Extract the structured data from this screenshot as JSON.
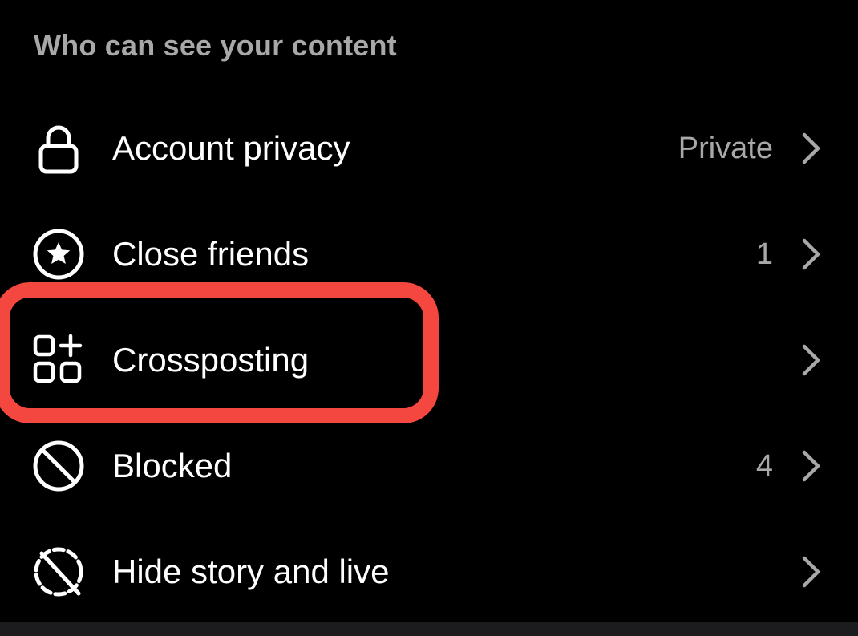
{
  "section": {
    "title": "Who can see your content"
  },
  "rows": [
    {
      "icon": "lock-icon",
      "label": "Account privacy",
      "value": "Private"
    },
    {
      "icon": "star-circle-icon",
      "label": "Close friends",
      "value": "1"
    },
    {
      "icon": "crosspost-apps-icon",
      "label": "Crossposting",
      "value": ""
    },
    {
      "icon": "block-icon",
      "label": "Blocked",
      "value": "4"
    },
    {
      "icon": "hide-story-icon",
      "label": "Hide story and live",
      "value": ""
    }
  ],
  "colors": {
    "background": "#000000",
    "primary_text": "#ffffff",
    "secondary_text": "#a8a8a8",
    "highlight": "#f3473f"
  },
  "highlight": {
    "target": "Crossposting"
  }
}
